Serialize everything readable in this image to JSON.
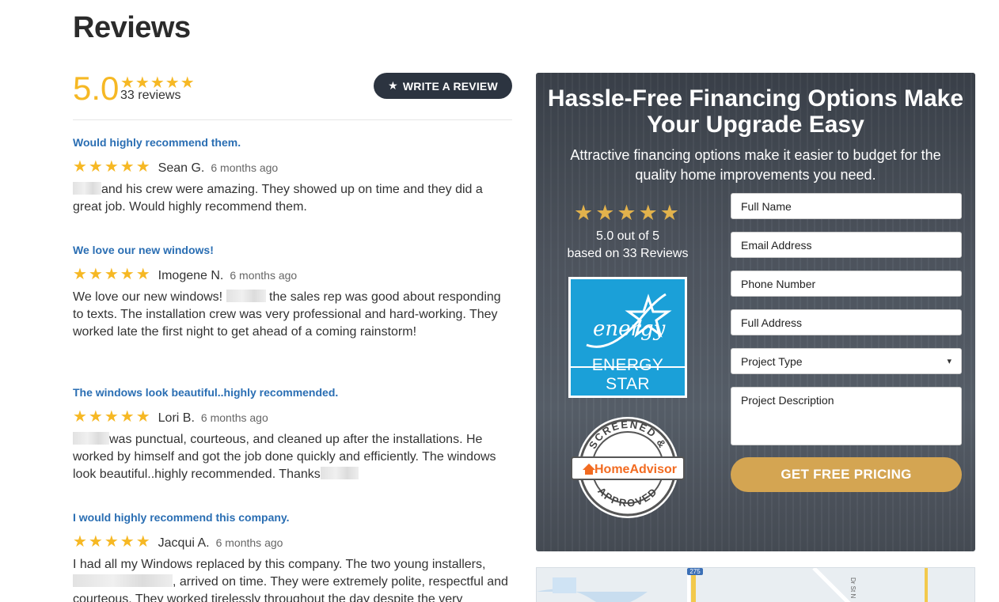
{
  "page": {
    "title": "Reviews"
  },
  "summary": {
    "score": "5.0",
    "stars": "★★★★★",
    "count": "33 reviews",
    "write_review_label": "WRITE A REVIEW"
  },
  "reviews": [
    {
      "title": "Would highly recommend them.",
      "stars": "★★★★★",
      "author": "Sean G.",
      "time": "6 months ago",
      "body_after": "and his crew were amazing. They showed up on time and they did a great job. Would highly recommend them."
    },
    {
      "title": "We love our new windows!",
      "stars": "★★★★★",
      "author": "Imogene N.",
      "time": "6 months ago",
      "body_before": "We love our new windows! ",
      "body_after": " the sales rep was good about responding to texts. The installation crew was very professional and hard-working. They worked late the first night to get ahead of a coming rainstorm!"
    },
    {
      "title": "The windows look beautiful..highly recommended.",
      "stars": "★★★★★",
      "author": "Lori B.",
      "time": "6 months ago",
      "body_after": "was punctual, courteous, and cleaned up after the installations. He worked by himself and got the job done quickly and efficiently. The windows look beautiful..highly recommended. Thanks"
    },
    {
      "title": "I would highly recommend this company.",
      "stars": "★★★★★",
      "author": "Jacqui A.",
      "time": "6 months ago",
      "body_line1": "I had all my Windows replaced by this company. The two young installers,",
      "body_after": ", arrived on time. They were extremely polite, respectful and courteous. They worked tirelessly throughout the day despite the very"
    }
  ],
  "financing": {
    "title": "Hassle-Free Financing Options Make Your Upgrade Easy",
    "subtitle": "Attractive financing options make it easier to budget for the quality home improvements you need.",
    "stars": "★★★★★",
    "rating_line1": "5.0 out of 5",
    "rating_line2": "based on 33 Reviews",
    "energy_star_label": "ENERGY STAR",
    "energy_star_script": "energy",
    "advisor_top": "SCREENED &",
    "advisor_bottom": "APPROVED",
    "advisor_brand": "HomeAdvisor",
    "fields": {
      "full_name": "Full Name",
      "email": "Email Address",
      "phone": "Phone Number",
      "address": "Full Address",
      "project_type": "Project Type",
      "project_description": "Project Description"
    },
    "cta_label": "GET FREE PRICING"
  },
  "map": {
    "route_label": "275",
    "street_label": "Dr St N"
  },
  "colors": {
    "star": "#f6b824",
    "link_blue": "#2a6eb3",
    "cta": "#d4a552",
    "energy_blue": "#1ba0d8",
    "dark_button": "#2c3440"
  }
}
